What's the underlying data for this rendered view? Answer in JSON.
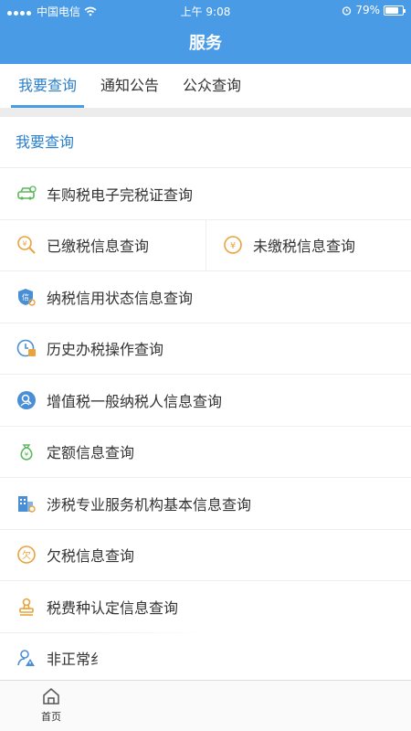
{
  "status": {
    "carrier": "中国电信",
    "time": "上午 9:08",
    "battery": "79%",
    "battery_level": 0.79
  },
  "header": {
    "title": "服务"
  },
  "tabs": [
    {
      "label": "我要查询"
    },
    {
      "label": "通知公告"
    },
    {
      "label": "公众查询"
    }
  ],
  "section": {
    "title": "我要查询"
  },
  "items": [
    {
      "label": "车购税电子完税证查询",
      "icon": "car-icon"
    },
    {
      "label": "已缴税信息查询",
      "icon": "yuan-search-icon"
    },
    {
      "label": "未缴税信息查询",
      "icon": "yuan-coin-icon"
    },
    {
      "label": "纳税信用状态信息查询",
      "icon": "credit-shield-icon"
    },
    {
      "label": "历史办税操作查询",
      "icon": "clock-tax-icon"
    },
    {
      "label": "增值税一般纳税人信息查询",
      "icon": "user-search-icon"
    },
    {
      "label": "定额信息查询",
      "icon": "money-bag-icon"
    },
    {
      "label": "涉税专业服务机构基本信息查询",
      "icon": "building-icon"
    },
    {
      "label": "欠税信息查询",
      "icon": "owe-tax-icon"
    },
    {
      "label": "税费种认定信息查询",
      "icon": "stamp-icon"
    },
    {
      "label": "非正常纟",
      "icon": "user-warning-icon"
    }
  ],
  "tabbar": {
    "home": "首页",
    "home_icon": "home-icon"
  }
}
